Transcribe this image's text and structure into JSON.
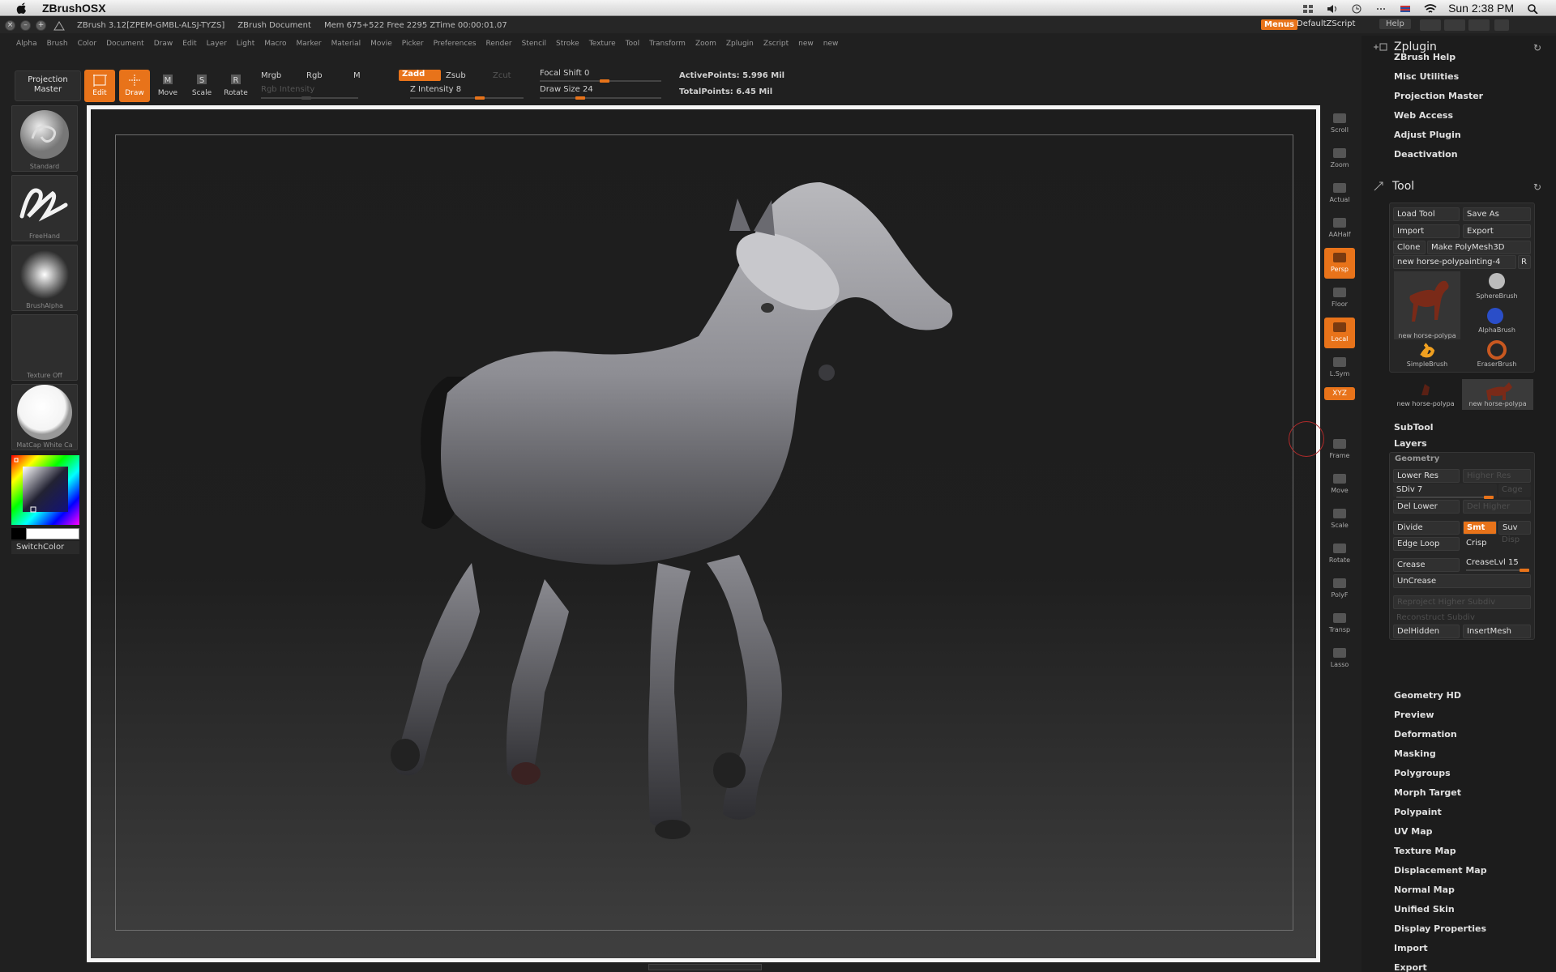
{
  "mac": {
    "app_name": "ZBrushOSX",
    "clock": "Sun 2:38 PM"
  },
  "titlebar": {
    "version": "ZBrush 3.12[ZPEM-GMBL-ALSJ-TYZS]",
    "document": "ZBrush Document",
    "memory": "Mem 675+522 Free 2295 ZTime 00:00:01.07",
    "menus_btn": "Menus",
    "default_script": "DefaultZScript",
    "help": "Help"
  },
  "menubar": [
    "Alpha",
    "Brush",
    "Color",
    "Document",
    "Draw",
    "Edit",
    "Layer",
    "Light",
    "Macro",
    "Marker",
    "Material",
    "Movie",
    "Picker",
    "Preferences",
    "Render",
    "Stencil",
    "Stroke",
    "Texture",
    "Tool",
    "Transform",
    "Zoom",
    "Zplugin",
    "Zscript",
    "new",
    "new"
  ],
  "shelf": {
    "projection_master": "Projection Master",
    "edit": "Edit",
    "draw": "Draw",
    "move": "Move",
    "scale": "Scale",
    "rotate": "Rotate",
    "mrgb": "Mrgb",
    "rgb": "Rgb",
    "m": "M",
    "rgb_intensity": "Rgb Intensity",
    "zadd": "Zadd",
    "zsub": "Zsub",
    "zcut": "Zcut",
    "z_intensity": "Z Intensity 8",
    "focal_shift": "Focal Shift 0",
    "draw_size": "Draw Size 24",
    "active_points": "ActivePoints: 5.996 Mil",
    "total_points": "TotalPoints: 6.45 Mil"
  },
  "left": {
    "standard": "Standard",
    "freehand": "FreeHand",
    "brushalpha": "BrushAlpha",
    "texture_off": "Texture Off",
    "matcap": "MatCap White Ca",
    "switchcolor": "SwitchColor"
  },
  "rightstrip": [
    "Scroll",
    "Zoom",
    "Actual",
    "AAHalf",
    "Persp",
    "Floor",
    "Local",
    "L.Sym",
    "XYZ",
    "Frame",
    "Move",
    "Scale",
    "Rotate",
    "PolyF",
    "Transp",
    "Lasso"
  ],
  "zplugin": {
    "title": "Zplugin",
    "items": [
      "ZBrush Help",
      "Misc Utilities",
      "Projection Master",
      "Web Access",
      "Adjust Plugin",
      "Deactivation"
    ]
  },
  "tool": {
    "title": "Tool",
    "load_tool": "Load Tool",
    "save_as": "Save As",
    "import": "Import",
    "export": "Export",
    "clone": "Clone",
    "make_polymesh": "Make PolyMesh3D",
    "current": "new horse-polypainting-4",
    "r": "R",
    "thumbs": [
      "new horse-polypa",
      "SphereBrush",
      "AlphaBrush",
      "SimpleBrush",
      "EraserBrush",
      "new horse-polypa",
      "new horse-polypa"
    ],
    "subtool": "SubTool",
    "layers": "Layers",
    "geometry": "Geometry",
    "lower_res": "Lower Res",
    "higher_res": "Higher Res",
    "sdiv": "SDiv 7",
    "cage": "Cage",
    "del_lower": "Del Lower",
    "del_higher": "Del Higher",
    "divide": "Divide",
    "smt": "Smt",
    "suv": "Suv",
    "edge_loop": "Edge Loop",
    "crisp": "Crisp",
    "disp": "Disp",
    "crease": "Crease",
    "creaselvl": "CreaseLvl 15",
    "uncrease": "UnCrease",
    "reproject": "Reproject Higher Subdiv",
    "reconstruct": "Reconstruct Subdiv",
    "delhidden": "DelHidden",
    "insertmesh": "InsertMesh",
    "sections": [
      "Geometry HD",
      "Preview",
      "Deformation",
      "Masking",
      "Polygroups",
      "Morph Target",
      "Polypaint",
      "UV Map",
      "Texture Map",
      "Displacement Map",
      "Normal Map",
      "Unified Skin",
      "Display Properties",
      "Import",
      "Export"
    ]
  },
  "colors": {
    "accent": "#e8731a",
    "canvas_frame": "#f6f6f6",
    "panel_bg": "#1c1c1c"
  }
}
